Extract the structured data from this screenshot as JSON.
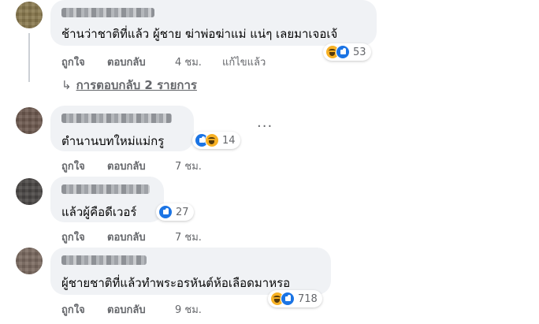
{
  "colors": {
    "bubble": "#f0f2f5",
    "secondary_text": "#65676b",
    "like_blue": "#1b74e4",
    "haha_yellow": "#f7b125"
  },
  "comments": [
    {
      "text": "ช้านว่าชาติที่แล้ว ผู้ชาย ฆ่าพ่อฆ่าแม่ แน่ๆ เลยมาเจอเจ้",
      "reactions": [
        "haha-icon",
        "like-icon"
      ],
      "reaction_count": "53",
      "actions": {
        "like": "ถูกใจ",
        "reply": "ตอบกลับ",
        "time": "4 ชม.",
        "edited": "แก้ไขแล้ว"
      },
      "replies_link": "การตอบกลับ 2 รายการ"
    },
    {
      "text": "ตำนานบทใหม่แม่กรู",
      "reactions": [
        "like-icon",
        "haha-icon"
      ],
      "reaction_count": "14",
      "actions": {
        "like": "ถูกใจ",
        "reply": "ตอบกลับ",
        "time": "7 ชม."
      },
      "more_menu": "···"
    },
    {
      "text": "แล้วผู้คือดีเวอร์",
      "reactions": [
        "like-icon"
      ],
      "reaction_count": "27",
      "actions": {
        "like": "ถูกใจ",
        "reply": "ตอบกลับ",
        "time": "7 ชม."
      }
    },
    {
      "text": "ผู้ชายชาติที่แล้วทำพระอรหันต์ห้อเลือดมาหรอ",
      "reactions": [
        "haha-icon",
        "like-icon"
      ],
      "reaction_count": "718",
      "actions": {
        "like": "ถูกใจ",
        "reply": "ตอบกลับ",
        "time": "9 ชม."
      }
    }
  ]
}
